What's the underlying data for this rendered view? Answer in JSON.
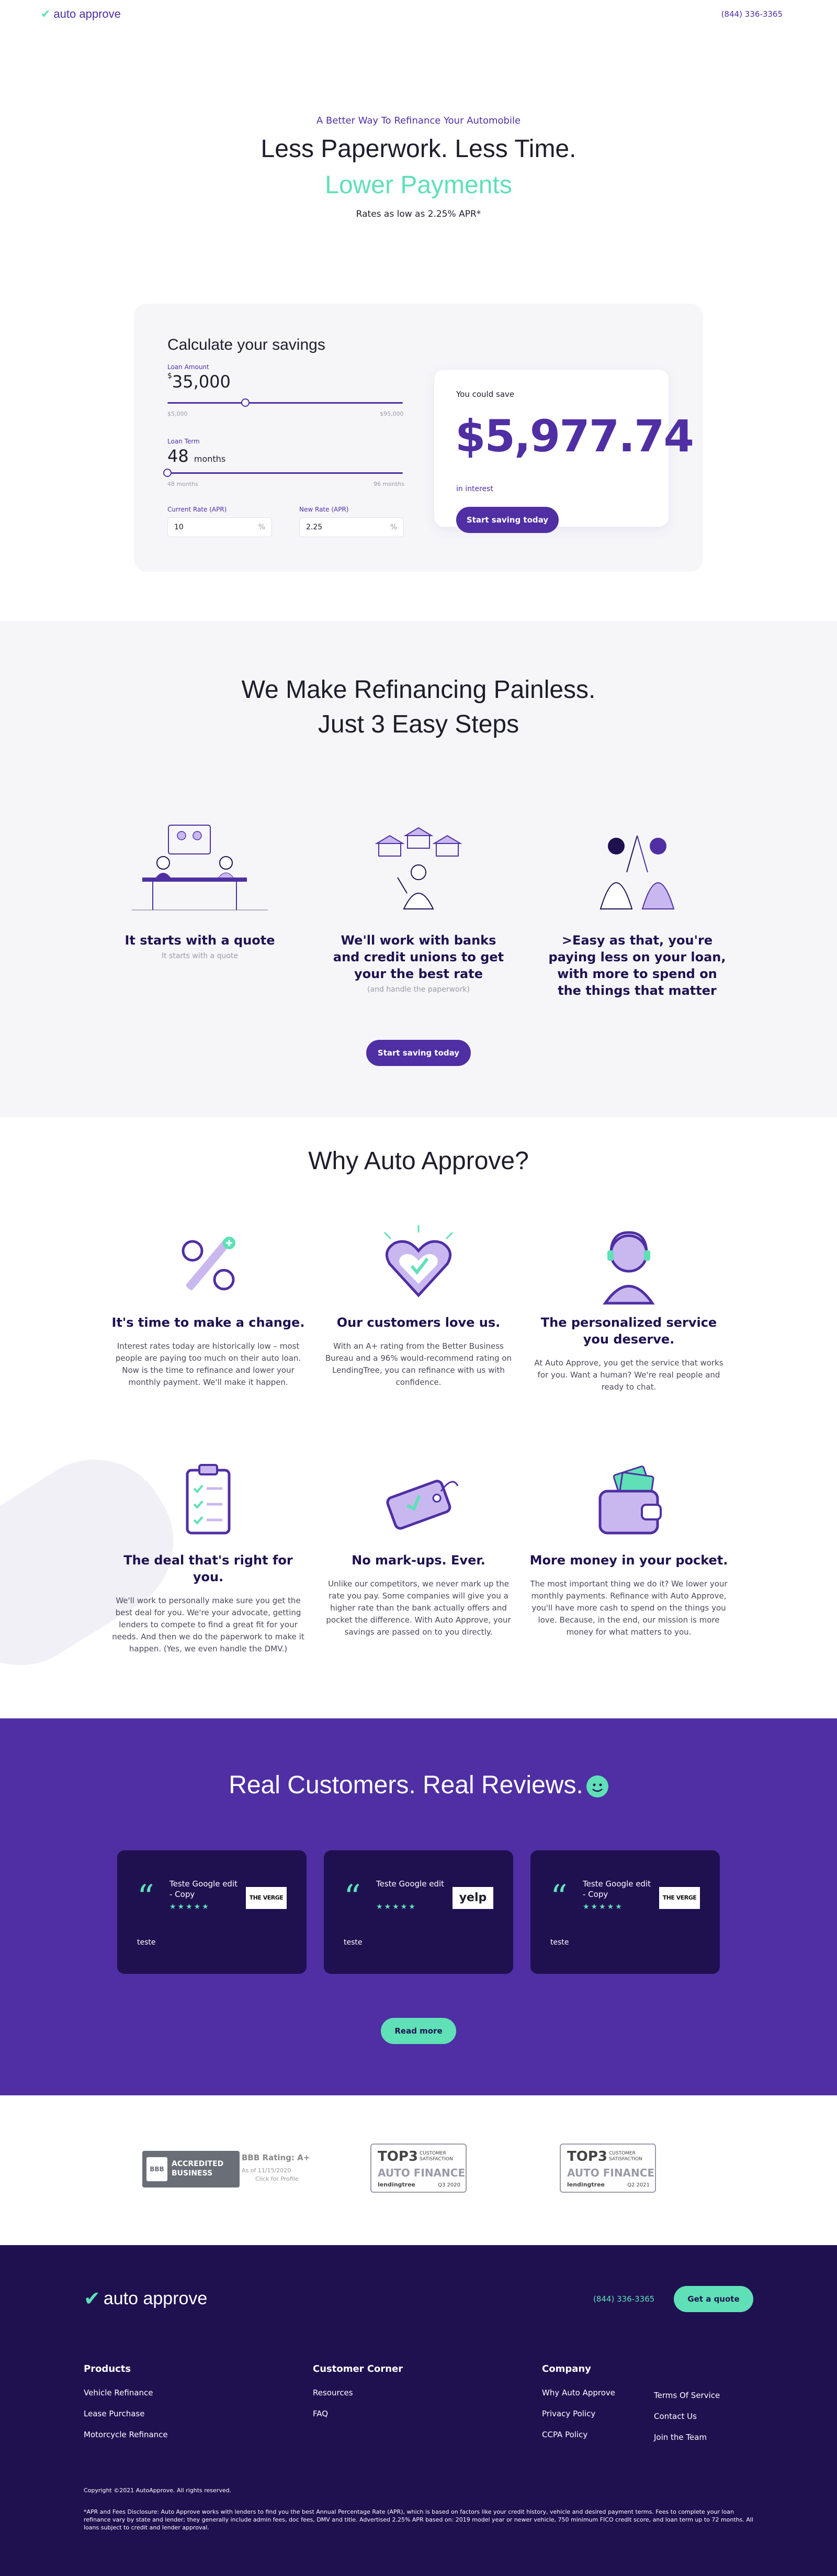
{
  "header": {
    "logo_text": "auto approve",
    "phone": "(844) 336-3365"
  },
  "hero": {
    "eyebrow": "A Better Way To Refinance Your Automobile",
    "line1": "Less Paperwork. Less Time.",
    "line2": "Lower Payments",
    "rates": "Rates as low as 2.25% APR*"
  },
  "calculator": {
    "title": "Calculate your savings",
    "loan_amount_label": "Loan Amount",
    "loan_amount_currency": "$",
    "loan_amount_value": "35,000",
    "loan_amount_fraction": 0.33,
    "loan_min": "$5,000",
    "loan_max": "$95,000",
    "loan_term_label": "Loan Term",
    "loan_term_value": "48",
    "loan_term_unit": "months",
    "loan_term_fraction": 0.0,
    "term_min": "48 months",
    "term_max": "96 months",
    "current_rate_label": "Current Rate (APR)",
    "current_rate_value": "10",
    "new_rate_label": "New Rate (APR)",
    "new_rate_value": "2.25",
    "percent_symbol": "%",
    "you_could_save": "You could save",
    "savings": "$5,977.74",
    "in_interest": "in interest",
    "cta": "Start saving today"
  },
  "steps": {
    "title_line1": "We Make Refinancing Painless.",
    "title_line2": "Just 3 Easy Steps",
    "items": [
      {
        "heading": "It starts with a quote",
        "sub": "It starts with a quote"
      },
      {
        "heading": "We'll work with banks and credit unions to get your the best rate",
        "sub": "(and handle the paperwork)"
      },
      {
        "heading": ">Easy as that, you're paying less on your loan, with more to spend on the things that matter",
        "sub": ""
      }
    ],
    "cta": "Start saving today"
  },
  "why": {
    "title": "Why Auto Approve?",
    "items": [
      {
        "heading": "It's time to make a change.",
        "text": "Interest rates today are historically low – most people are paying too much on their auto loan. Now is the time to refinance and lower your monthly payment. We'll make it happen."
      },
      {
        "heading": "Our customers love us.",
        "text": "With an A+ rating from the Better Business Bureau and a 96% would-recommend rating on LendingTree, you can refinance with us with confidence."
      },
      {
        "heading": "The personalized service you deserve.",
        "text": "At Auto Approve, you get the service that works for you. Want a human? We're real people and ready to chat."
      },
      {
        "heading": "The deal that's right for you.",
        "text": "We'll work to personally make sure you get the best deal for you. We're your advocate, getting lenders to compete to find a great fit for your needs. And then we do the paperwork to make it happen. (Yes, we even handle the DMV.)"
      },
      {
        "heading": "No mark-ups. Ever.",
        "text": "Unlike our competitors, we never mark up the rate you pay. Some companies will give you a higher rate than the bank actually offers and pocket the difference. With Auto Approve, your savings are passed on to you directly."
      },
      {
        "heading": "More money in your pocket.",
        "text": "The most important thing we do it? We lower your monthly payments. Refinance with Auto Approve, you'll have more cash to spend on the things you love. Because, in the end, our mission is more money for what matters to you."
      }
    ]
  },
  "reviews": {
    "title": "Real Customers. Real Reviews.",
    "cards": [
      {
        "name": "Teste Google edit - Copy",
        "stars": "★★★★★",
        "logo": "THE VERGE",
        "body": "teste"
      },
      {
        "name": "Teste Google edit",
        "stars": "★★★★★",
        "logo": "yelp",
        "body": "teste"
      },
      {
        "name": "Teste Google edit - Copy",
        "stars": "★★★★★",
        "logo": "THE VERGE",
        "body": "teste"
      }
    ],
    "cta": "Read more"
  },
  "awards": {
    "bbb_seal": "BBB",
    "bbb_badge": "ACCREDITED BUSINESS",
    "bbb_rating": "BBB Rating: A+",
    "bbb_date": "As of 11/15/2020",
    "bbb_click": "Click for Profile",
    "top3": [
      {
        "big": "TOP3",
        "small": "CUSTOMER SATISFACTION",
        "category": "AUTO FINANCE",
        "brand": "lendingtree",
        "quarter": "Q3 2020"
      },
      {
        "big": "TOP3",
        "small": "CUSTOMER SATISFACTION",
        "category": "AUTO FINANCE",
        "brand": "lendingtree",
        "quarter": "Q2 2021"
      }
    ]
  },
  "footer": {
    "logo_text": "auto approve",
    "phone": "(844) 336-3365",
    "cta": "Get a quote",
    "products": {
      "title": "Products",
      "links": [
        "Vehicle Refinance",
        "Lease Purchase",
        "Motorcycle Refinance"
      ]
    },
    "customer": {
      "title": "Customer Corner",
      "links": [
        "Resources",
        "FAQ"
      ]
    },
    "company": {
      "title": "Company",
      "links": [
        "Why Auto Approve",
        "Privacy Policy",
        "CCPA Policy"
      ],
      "links2": [
        "Terms Of Service",
        "Contact Us",
        "Join the Team"
      ]
    },
    "copyright": "Copyright ©2021 AutoApprove. All rights reserved.",
    "disclosure": "*APR and Fees Disclosure: Auto Approve works with lenders to find you the best Annual Percentage Rate (APR), which is based on factors like your credit history, vehicle and desired payment terms. Fees to complete your loan refinance vary by state and lender; they generally include admin fees, doc fees, DMV and title. Advertised 2.25% APR based on: 2019 model year or newer vehicle, 750 minimum FICO credit score, and loan term up to 72 months. All loans subject to credit and lender approval."
  },
  "colors": {
    "primary": "#4f2fa3",
    "accent": "#5fe0b7",
    "dark": "#1f1150",
    "light_bg": "#f6f6f9"
  }
}
